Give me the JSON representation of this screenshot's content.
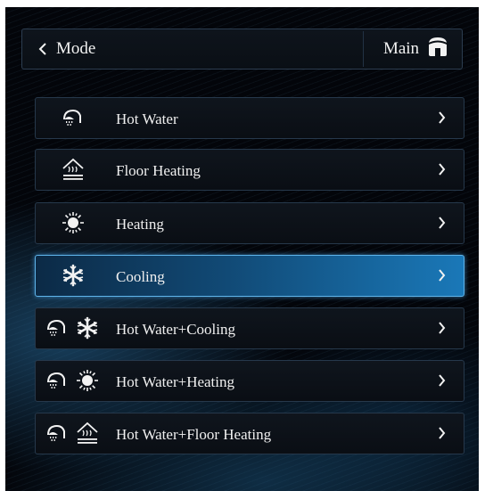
{
  "header": {
    "back_label": "Mode",
    "main_label": "Main"
  },
  "accent_color": "#1a78b8",
  "menu": {
    "items": [
      {
        "label": "Hot Water",
        "icons": [
          "shower-icon"
        ],
        "selected": false
      },
      {
        "label": "Floor Heating",
        "icons": [
          "floor-heating-icon"
        ],
        "selected": false
      },
      {
        "label": "Heating",
        "icons": [
          "sun-icon"
        ],
        "selected": false
      },
      {
        "label": "Cooling",
        "icons": [
          "snowflake-icon"
        ],
        "selected": true
      },
      {
        "label": "Hot Water+Cooling",
        "icons": [
          "shower-icon",
          "snowflake-icon"
        ],
        "selected": false
      },
      {
        "label": "Hot Water+Heating",
        "icons": [
          "shower-icon",
          "sun-icon"
        ],
        "selected": false
      },
      {
        "label": "Hot Water+Floor Heating",
        "icons": [
          "shower-icon",
          "floor-heating-icon"
        ],
        "selected": false
      }
    ]
  }
}
